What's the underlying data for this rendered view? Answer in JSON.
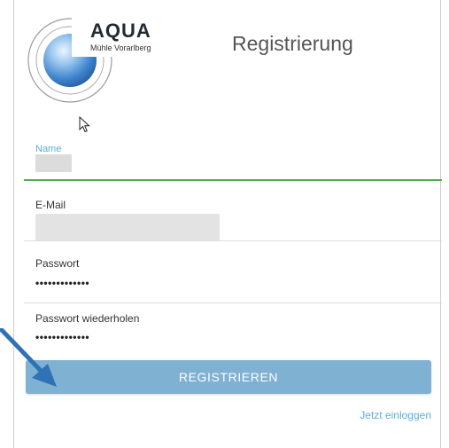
{
  "logo": {
    "title": "AQUA",
    "subtitle": "Mühle Vorarlberg"
  },
  "page": {
    "title": "Registrierung"
  },
  "form": {
    "name": {
      "label": "Name",
      "value": ""
    },
    "email": {
      "label": "E-Mail",
      "value": ""
    },
    "password": {
      "label": "Passwort",
      "value": "•••••••••••••"
    },
    "password_repeat": {
      "label": "Passwort wiederholen",
      "value": "•••••••••••••"
    },
    "submit_label": "REGISTRIEREN"
  },
  "links": {
    "login": "Jetzt einloggen"
  },
  "colors": {
    "accent": "#5aaed8",
    "button": "#7fb1d3",
    "active_underline": "#4caf50",
    "annotation_arrow": "#2f72b5"
  }
}
